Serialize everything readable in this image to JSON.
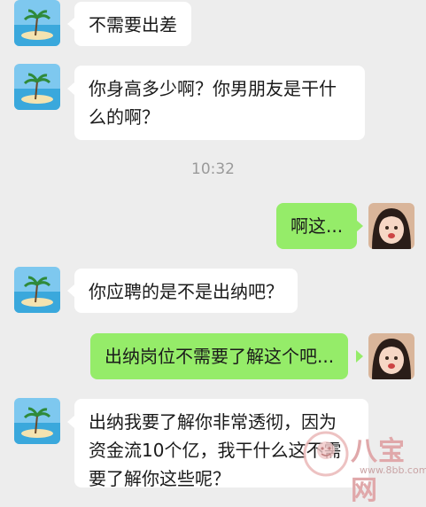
{
  "messages": [
    {
      "side": "in",
      "text": "不需要出差"
    },
    {
      "side": "in",
      "text": "你身高多少啊？你男朋友是干什么的啊？",
      "lines": [
        "你身高多少啊？你男朋友是干什",
        "么的啊？"
      ]
    },
    {
      "side": "out",
      "text": "啊这..."
    },
    {
      "side": "in",
      "text": "你应聘的是不是出纳吧？"
    },
    {
      "side": "out",
      "text": "出纳岗位不需要了解这个吧..."
    },
    {
      "side": "in",
      "text": "出纳我要了解你非常透彻，因为资金流10个亿，我干什么这不需要了解你这些呢？",
      "lines": [
        "出纳我要了解你非常透彻，因为",
        "资金流10个亿，我干什么这不需",
        "要了解你这些呢？"
      ]
    }
  ],
  "timestamp": "10:32",
  "watermark": {
    "brand": "八宝网",
    "url": "www.8bb.com"
  },
  "colors": {
    "background": "#ededed",
    "incoming": "#ffffff",
    "outgoing": "#95ec69",
    "timestamp": "#9a9a9a"
  }
}
